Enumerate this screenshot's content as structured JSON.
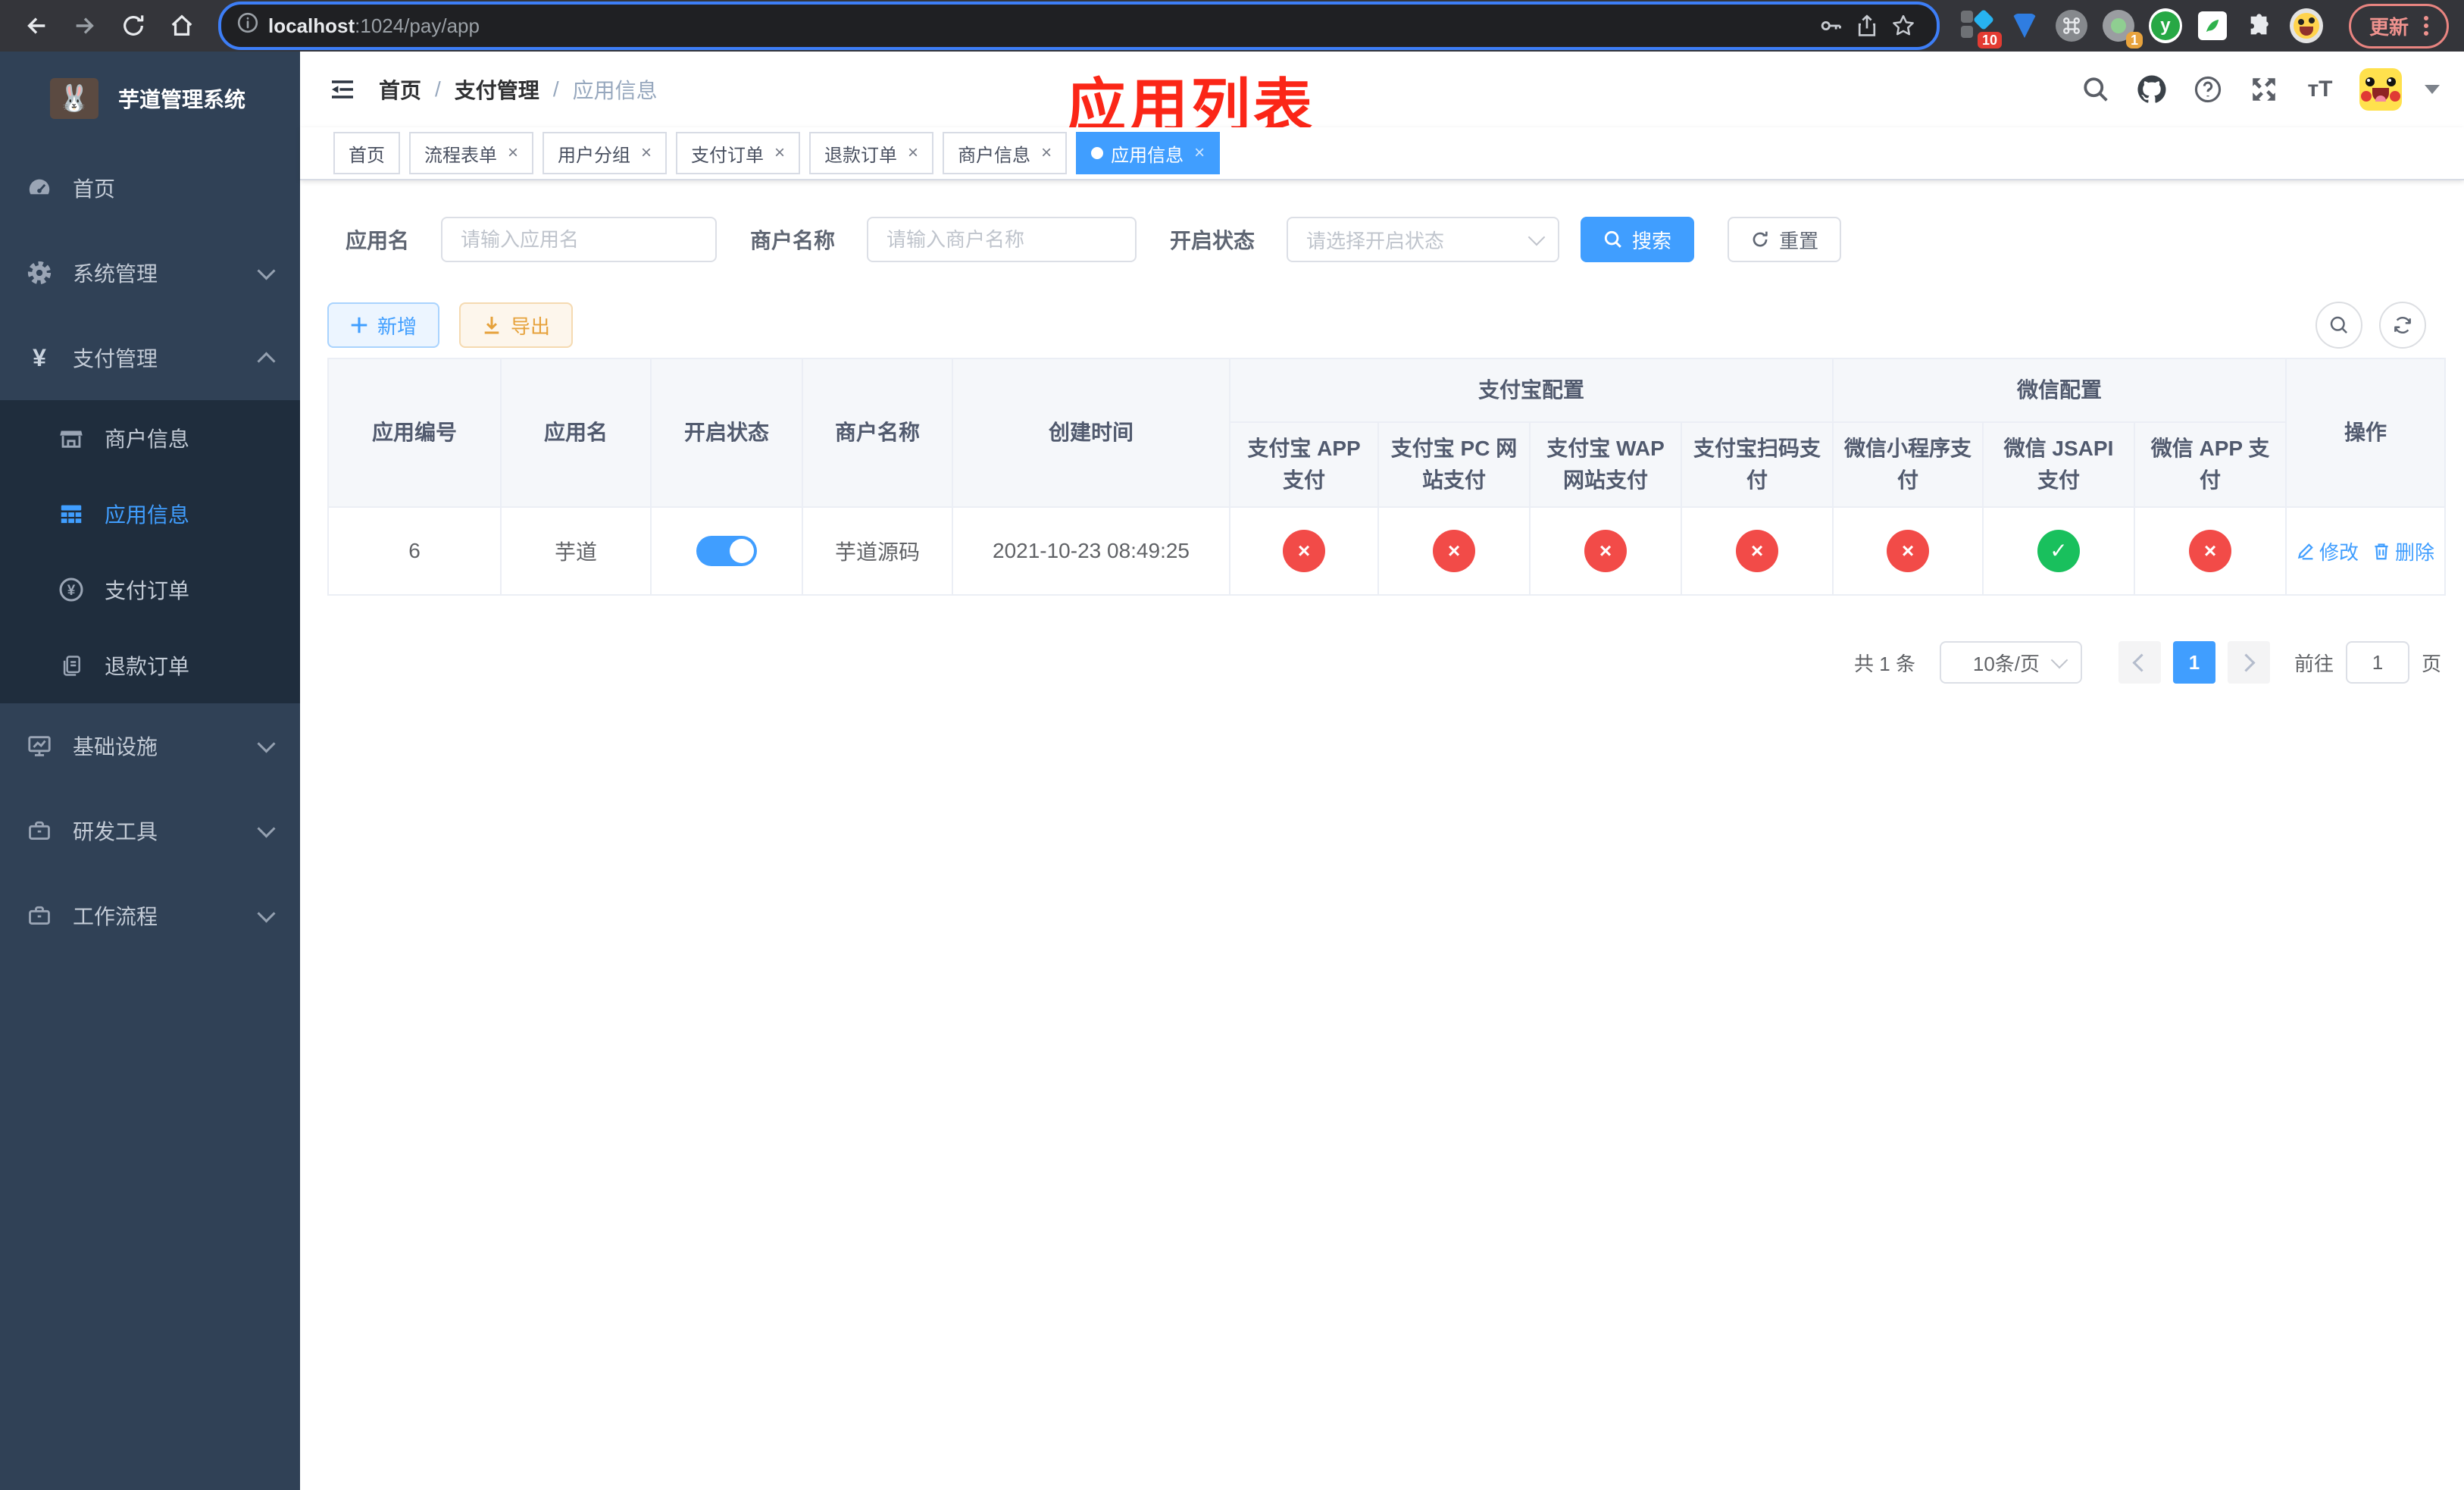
{
  "colors": {
    "accent": "#409eff",
    "success": "#19c05d",
    "danger": "#f24b48",
    "warning": "#e6a23c",
    "sidebar_bg": "#304156",
    "submenu_bg": "#1f2d3d"
  },
  "browser": {
    "url_host": "localhost",
    "url_path": ":1024/pay/app",
    "ext_badge_blue_diamond": "10",
    "ext_badge_record": "1",
    "ext_letter": "y",
    "update_button": "更新"
  },
  "sidebar": {
    "title": "芋道管理系统",
    "items": [
      {
        "label": "首页"
      },
      {
        "label": "系统管理"
      },
      {
        "label": "支付管理"
      },
      {
        "label": "商户信息"
      },
      {
        "label": "应用信息"
      },
      {
        "label": "支付订单"
      },
      {
        "label": "退款订单"
      },
      {
        "label": "基础设施"
      },
      {
        "label": "研发工具"
      },
      {
        "label": "工作流程"
      }
    ]
  },
  "header": {
    "breadcrumb": [
      "首页",
      "支付管理",
      "应用信息"
    ],
    "separator": "/",
    "annotation": "应用列表"
  },
  "tabs": [
    {
      "label": "首页"
    },
    {
      "label": "流程表单"
    },
    {
      "label": "用户分组"
    },
    {
      "label": "支付订单"
    },
    {
      "label": "退款订单"
    },
    {
      "label": "商户信息"
    },
    {
      "label": "应用信息"
    }
  ],
  "filters": {
    "app_name_label": "应用名",
    "app_name_placeholder": "请输入应用名",
    "merchant_label": "商户名称",
    "merchant_placeholder": "请输入商户名称",
    "status_label": "开启状态",
    "status_placeholder": "请选择开启状态",
    "search_button": "搜索",
    "reset_button": "重置"
  },
  "toolbar": {
    "add_button": "新增",
    "export_button": "导出"
  },
  "table": {
    "columns": {
      "id": "应用编号",
      "name": "应用名",
      "enabled": "开启状态",
      "merchant": "商户名称",
      "created": "创建时间",
      "op": "操作"
    },
    "group_alipay": "支付宝配置",
    "group_wechat": "微信配置",
    "pay_columns": [
      "支付宝 APP 支付",
      "支付宝 PC 网站支付",
      "支付宝 WAP 网站支付",
      "支付宝扫码支付",
      "微信小程序支付",
      "微信 JSAPI 支付",
      "微信 APP 支付"
    ],
    "row": {
      "id": "6",
      "name": "芋道",
      "enabled": true,
      "merchant": "芋道源码",
      "created": "2021-10-23 08:49:25",
      "channels": [
        "cross",
        "cross",
        "cross",
        "cross",
        "cross",
        "check",
        "cross"
      ],
      "edit_label": "修改",
      "delete_label": "删除"
    }
  },
  "pagination": {
    "total": "共 1 条",
    "page_size": "10条/页",
    "page": "1",
    "goto_label": "前往",
    "goto_value": "1",
    "page_unit": "页"
  },
  "icons": {
    "close": "×",
    "cross": "×",
    "check": "✓",
    "currency": "¥",
    "font_size": "тT"
  }
}
